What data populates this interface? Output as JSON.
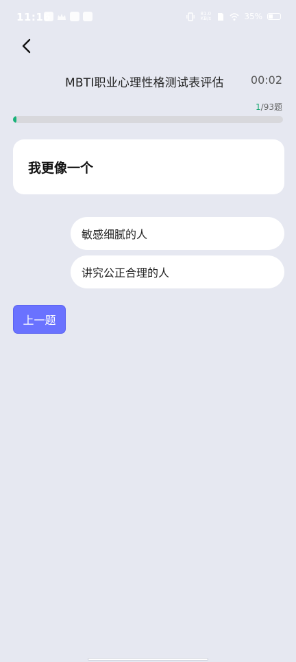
{
  "status_bar": {
    "time": "11:16",
    "net_speed_value": "81.0",
    "net_speed_unit": "KB/s",
    "battery": "35%"
  },
  "header": {
    "title": "MBTI职业心理性格测试表评估",
    "timer": "00:02"
  },
  "progress": {
    "current": "1",
    "total_label": "/93题",
    "fraction": 0.0108
  },
  "question": {
    "text": "我更像一个"
  },
  "options": [
    {
      "label": "敏感细腻的人"
    },
    {
      "label": "讲究公正合理的人"
    }
  ],
  "actions": {
    "prev_label": "上一题"
  },
  "colors": {
    "background": "#e6e8f1",
    "accent": "#6a72ff",
    "progress": "#18b27a"
  }
}
